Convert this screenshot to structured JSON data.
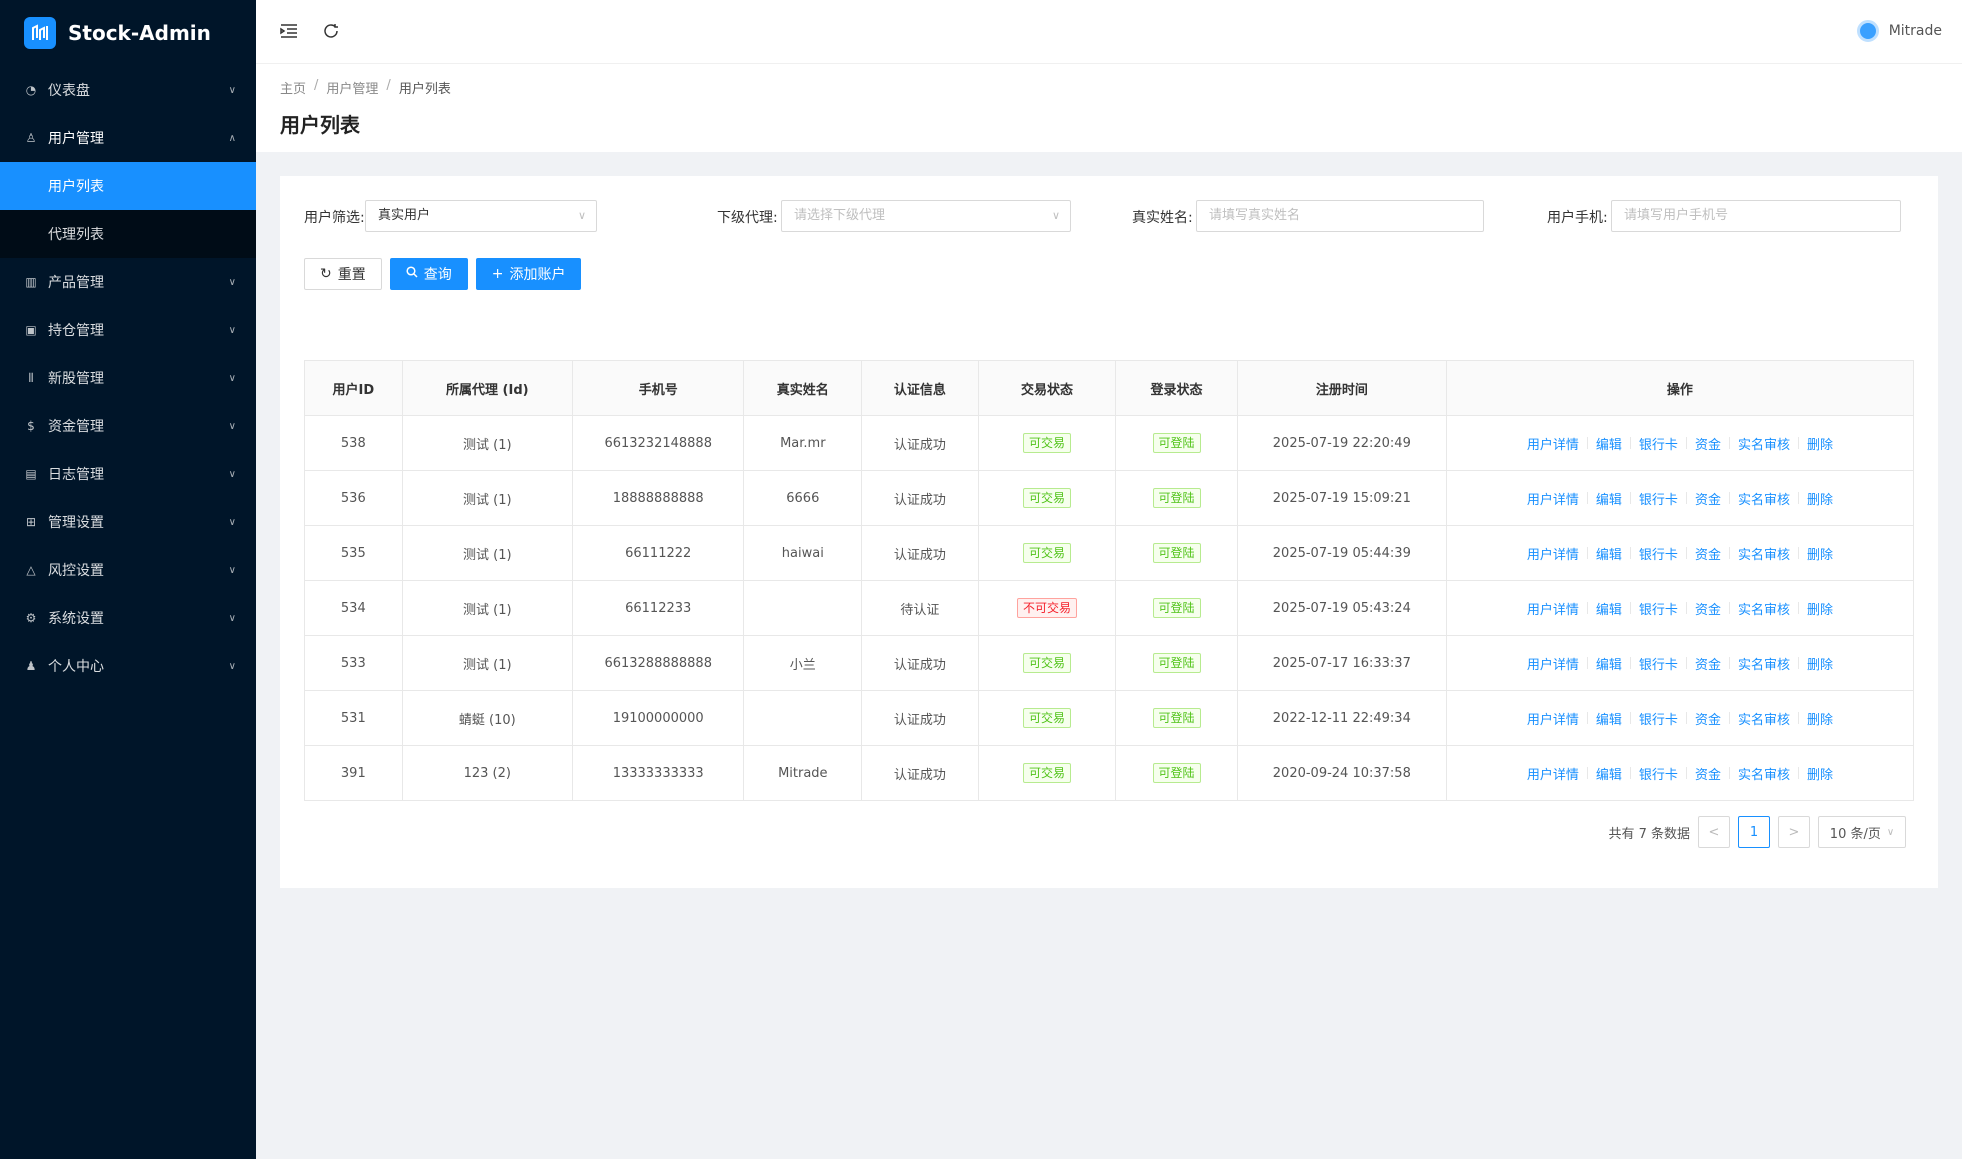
{
  "app": {
    "title": "Stock-Admin"
  },
  "sidebar": {
    "items": [
      {
        "label": "仪表盘",
        "icon": "dashboard-icon"
      },
      {
        "label": "用户管理",
        "icon": "team-icon",
        "open": true,
        "children": [
          {
            "label": "用户列表",
            "active": true
          },
          {
            "label": "代理列表"
          }
        ]
      },
      {
        "label": "产品管理",
        "icon": "chart-icon"
      },
      {
        "label": "持仓管理",
        "icon": "position-icon"
      },
      {
        "label": "新股管理",
        "icon": "ipo-icon"
      },
      {
        "label": "资金管理",
        "icon": "money-icon"
      },
      {
        "label": "日志管理",
        "icon": "log-icon"
      },
      {
        "label": "管理设置",
        "icon": "admin-settings-icon"
      },
      {
        "label": "风控设置",
        "icon": "warning-icon"
      },
      {
        "label": "系统设置",
        "icon": "gear-icon"
      },
      {
        "label": "个人中心",
        "icon": "user-icon"
      }
    ]
  },
  "header": {
    "username": "Mitrade"
  },
  "breadcrumb": [
    "主页",
    "用户管理",
    "用户列表"
  ],
  "page": {
    "title": "用户列表"
  },
  "filters": {
    "user_filter": {
      "label": "用户筛选:",
      "value": "真实用户"
    },
    "sub_agent": {
      "label": "下级代理:",
      "placeholder": "请选择下级代理"
    },
    "real_name": {
      "label": "真实姓名:",
      "placeholder": "请填写真实姓名"
    },
    "user_phone": {
      "label": "用户手机:",
      "placeholder": "请填写用户手机号"
    }
  },
  "buttons": {
    "reset": "重置",
    "query": "查询",
    "add_account": "添加账户"
  },
  "table": {
    "columns": [
      "用户ID",
      "所属代理 (Id)",
      "手机号",
      "真实姓名",
      "认证信息",
      "交易状态",
      "登录状态",
      "注册时间",
      "操作"
    ],
    "rows": [
      {
        "id": "538",
        "agent": "测试 (1)",
        "phone": "6613232148888",
        "name": "Mar.mr",
        "auth": "认证成功",
        "trade": "可交易",
        "trade_ok": true,
        "login": "可登陆",
        "time": "2025-07-19 22:20:49"
      },
      {
        "id": "536",
        "agent": "测试 (1)",
        "phone": "18888888888",
        "name": "6666",
        "auth": "认证成功",
        "trade": "可交易",
        "trade_ok": true,
        "login": "可登陆",
        "time": "2025-07-19 15:09:21"
      },
      {
        "id": "535",
        "agent": "测试 (1)",
        "phone": "66111222",
        "name": "haiwai",
        "auth": "认证成功",
        "trade": "可交易",
        "trade_ok": true,
        "login": "可登陆",
        "time": "2025-07-19 05:44:39"
      },
      {
        "id": "534",
        "agent": "测试 (1)",
        "phone": "66112233",
        "name": "",
        "auth": "待认证",
        "trade": "不可交易",
        "trade_ok": false,
        "login": "可登陆",
        "time": "2025-07-19 05:43:24"
      },
      {
        "id": "533",
        "agent": "测试 (1)",
        "phone": "6613288888888",
        "name": "小兰",
        "auth": "认证成功",
        "trade": "可交易",
        "trade_ok": true,
        "login": "可登陆",
        "time": "2025-07-17 16:33:37"
      },
      {
        "id": "531",
        "agent": "蜻蜓 (10)",
        "phone": "19100000000",
        "name": "",
        "auth": "认证成功",
        "trade": "可交易",
        "trade_ok": true,
        "login": "可登陆",
        "time": "2022-12-11 22:49:34"
      },
      {
        "id": "391",
        "agent": "123 (2)",
        "phone": "13333333333",
        "name": "Mitrade",
        "auth": "认证成功",
        "trade": "可交易",
        "trade_ok": true,
        "login": "可登陆",
        "time": "2020-09-24 10:37:58"
      }
    ],
    "actions": [
      "用户详情",
      "编辑",
      "银行卡",
      "资金",
      "实名审核",
      "删除"
    ]
  },
  "pagination": {
    "total_text": "共有 7 条数据",
    "current": "1",
    "page_size": "10 条/页"
  },
  "colors": {
    "sidebar_bg": "#001529",
    "primary": "#1890ff",
    "success": "#52c41a",
    "danger": "#f5222d"
  }
}
